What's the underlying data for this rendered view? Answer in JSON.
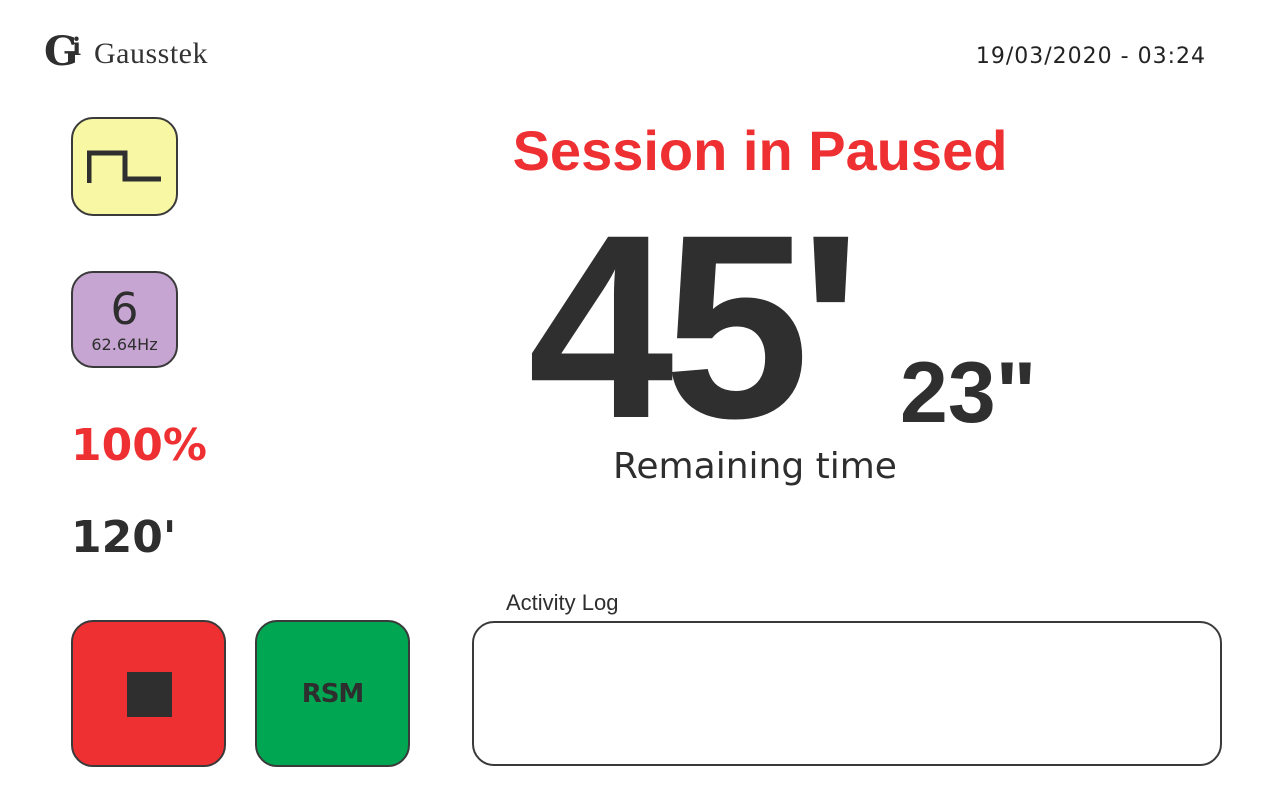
{
  "header": {
    "brand_letter": "G",
    "brand_mark_i": "i",
    "brand_name": "Gausstek",
    "datetime": "19/03/2020 - 03:24"
  },
  "left_panel": {
    "waveform": {
      "icon": "square-wave-icon",
      "color": "#f7f7a4"
    },
    "channel": {
      "number": "6",
      "frequency": "62.64Hz",
      "color": "#c6a5d2"
    },
    "intensity": "100%",
    "total_duration": "120'",
    "stop_button": {
      "icon": "stop-icon",
      "color": "#ee3033"
    },
    "resume_button": {
      "label": "RSM",
      "color": "#00a651"
    }
  },
  "main": {
    "status": "Session in Paused",
    "remaining_minutes": "45'",
    "remaining_seconds": "23\"",
    "remaining_label": "Remaining time",
    "log": {
      "label": "Activity Log",
      "entries": []
    }
  },
  "colors": {
    "accent_red": "#ee3033",
    "text_dark": "#2e2e2e",
    "green": "#00a651"
  }
}
